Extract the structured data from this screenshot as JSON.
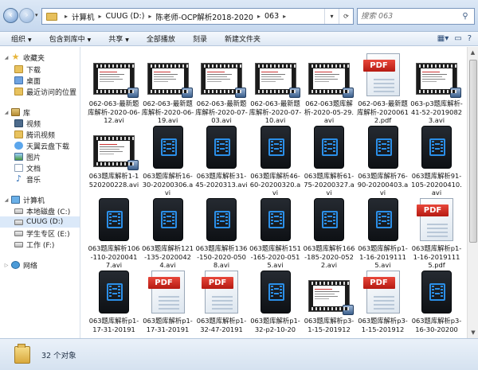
{
  "address": {
    "path": [
      "计算机",
      "CUUG (D:)",
      "陈老师-OCP解析2018-2020",
      "063"
    ]
  },
  "search": {
    "placeholder": "搜索 063"
  },
  "toolbar": {
    "organize": "组织",
    "include": "包含到库中",
    "share": "共享",
    "play_all": "全部播放",
    "burn": "刻录",
    "new_folder": "新建文件夹"
  },
  "nav": {
    "favorites": "收藏夹",
    "downloads": "下载",
    "desktop": "桌面",
    "recent": "最近访问的位置",
    "libraries": "库",
    "videos": "视频",
    "tencent_video": "腾讯视频",
    "tianyi_cloud": "天翼云盘下载",
    "pictures": "图片",
    "documents": "文档",
    "music": "音乐",
    "computer": "计算机",
    "drive_c": "本地磁盘 (C:)",
    "drive_d": "CUUG (D:)",
    "drive_e": "学生专区 (E:)",
    "drive_f": "工作 (F:)",
    "network": "网络"
  },
  "files": [
    {
      "name": "062-063-最新题库解析-2020-06-12.avi",
      "kind": "film"
    },
    {
      "name": "062-063-最新题库解析-2020-06-19.avi",
      "kind": "film"
    },
    {
      "name": "062-063-最新题库解析-2020-07-03.avi",
      "kind": "film"
    },
    {
      "name": "062-063-最新题库解析-2020-07-10.avi",
      "kind": "film"
    },
    {
      "name": "062-063题库解析-2020-05-29.avi",
      "kind": "film"
    },
    {
      "name": "062-063-最新题库解析-20200612.pdf",
      "kind": "pdf"
    },
    {
      "name": "063-p3题库解析-41-52-20190823.avi",
      "kind": "film"
    },
    {
      "name": "063题库解析1-1520200228.avi",
      "kind": "film"
    },
    {
      "name": "063题库解析16-30-20200306.avi",
      "kind": "video"
    },
    {
      "name": "063题库解析31-45-2020313.avi",
      "kind": "video"
    },
    {
      "name": "063题库解析46-60-20200320.avi",
      "kind": "video"
    },
    {
      "name": "063题库解析61-75-20200327.avi",
      "kind": "video"
    },
    {
      "name": "063题库解析76-90-20200403.avi",
      "kind": "video"
    },
    {
      "name": "063题库解析91-105-20200410.avi",
      "kind": "video"
    },
    {
      "name": "063题库解析106-110-20200417.avi",
      "kind": "video"
    },
    {
      "name": "063题库解析121-135-20200424.avi",
      "kind": "video"
    },
    {
      "name": "063题库解析136-150-2020-0508.avi",
      "kind": "video"
    },
    {
      "name": "063题库解析151-165-2020-0515.avi",
      "kind": "video"
    },
    {
      "name": "063题库解析166-185-2020-0522.avi",
      "kind": "video"
    },
    {
      "name": "063题库解析p1-1-16-20191115.avi",
      "kind": "video"
    },
    {
      "name": "063题库解析p1-1-16-20191115.pdf",
      "kind": "pdf"
    },
    {
      "name": "063题库解析p1-17-31-20191",
      "kind": "video"
    },
    {
      "name": "063题库解析p1-17-31-20191",
      "kind": "pdf"
    },
    {
      "name": "063题库解析p1-32-47-20191",
      "kind": "pdf"
    },
    {
      "name": "063题库解析p1-32-p2-10-20",
      "kind": "video"
    },
    {
      "name": "063题库解析p3-1-15-201912",
      "kind": "film"
    },
    {
      "name": "063题库解析p3-1-15-201912",
      "kind": "pdf"
    },
    {
      "name": "063题库解析p3-16-30-20200",
      "kind": "video"
    }
  ],
  "status": {
    "count_text": "32 个对象"
  }
}
